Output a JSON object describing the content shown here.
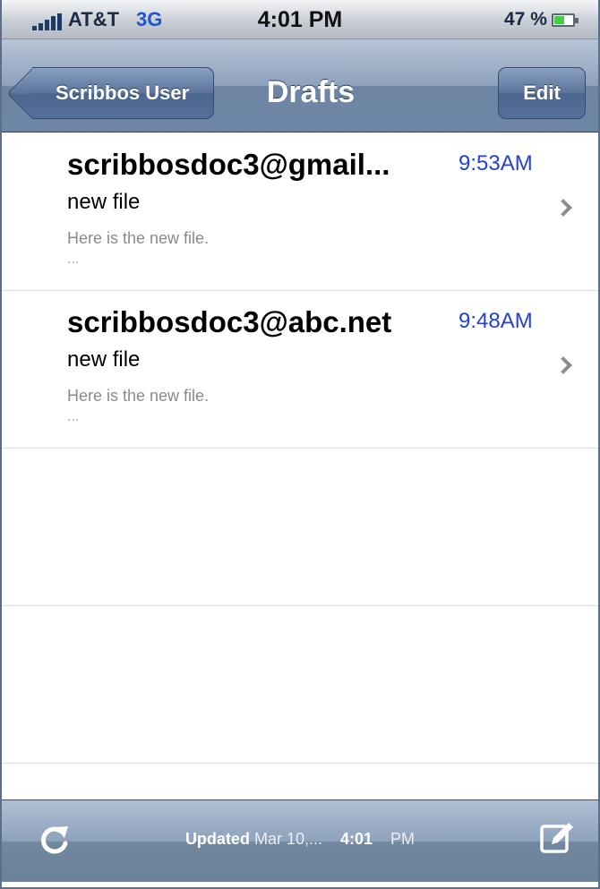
{
  "status_bar": {
    "carrier": "AT&T",
    "network": "3G",
    "time": "4:01 PM",
    "battery_percent": "47 %",
    "icons": [
      "signal-bars-icon",
      "battery-icon"
    ]
  },
  "nav_bar": {
    "back_label": "Scribbos User",
    "title": "Drafts",
    "edit_label": "Edit"
  },
  "messages": [
    {
      "sender": "scribbosdoc3@gmail...",
      "time": "9:53AM",
      "subject": "new file",
      "preview": "Here is the new file.",
      "ellipsis": "..."
    },
    {
      "sender": "scribbosdoc3@abc.net",
      "time": "9:48AM",
      "subject": "new file",
      "preview": "Here is the new file.",
      "ellipsis": "..."
    }
  ],
  "toolbar": {
    "updated_label": "Updated",
    "updated_date": "Mar 10,...",
    "updated_time": "4:01",
    "updated_ampm": "PM",
    "icons": [
      "refresh-icon",
      "compose-icon"
    ]
  },
  "colors": {
    "nav_bar": "#6f87a6",
    "time_link": "#2141d8",
    "network": "#1f57c8"
  }
}
